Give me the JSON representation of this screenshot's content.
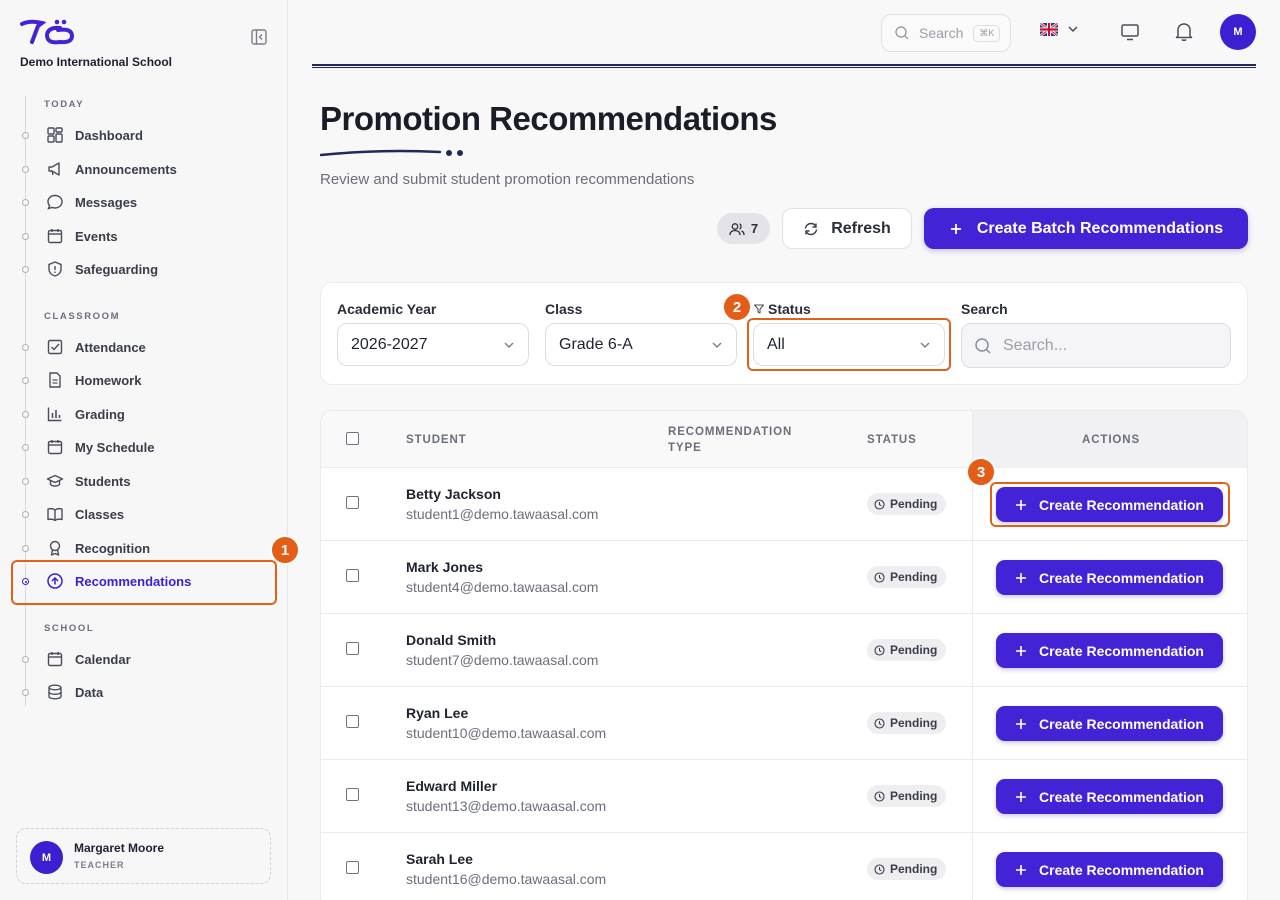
{
  "sidebar": {
    "brand_name": "Demo International School",
    "sections": {
      "today": "TODAY",
      "classroom": "CLASSROOM",
      "school": "SCHOOL"
    },
    "items": {
      "dashboard": "Dashboard",
      "announcements": "Announcements",
      "messages": "Messages",
      "events": "Events",
      "safeguarding": "Safeguarding",
      "attendance": "Attendance",
      "homework": "Homework",
      "grading": "Grading",
      "my_schedule": "My Schedule",
      "students": "Students",
      "classes": "Classes",
      "recognition": "Recognition",
      "recommendations": "Recommendations",
      "calendar": "Calendar",
      "data": "Data"
    },
    "active_item": "recommendations",
    "user": {
      "initial": "M",
      "name": "Margaret Moore",
      "role": "TEACHER"
    }
  },
  "topbar": {
    "search_placeholder": "Search",
    "search_shortcut": "⌘K",
    "avatar_initial": "M",
    "icons": [
      "search-icon",
      "uk-flag-icon",
      "chevron-down-icon",
      "monitor-icon",
      "bell-icon"
    ]
  },
  "header": {
    "title": "Promotion Recommendations",
    "subtitle": "Review and submit student promotion recommendations",
    "count": "7",
    "refresh_label": "Refresh",
    "batch_label": "Create Batch Recommendations"
  },
  "filters": {
    "academic_year": {
      "label": "Academic Year",
      "value": "2026-2027"
    },
    "class": {
      "label": "Class",
      "value": "Grade 6-A"
    },
    "status": {
      "label": "Status",
      "value": "All"
    },
    "search": {
      "label": "Search",
      "placeholder": "Search..."
    }
  },
  "table": {
    "headers": {
      "student": "STUDENT",
      "recommendation_type_1": "RECOMMENDATION",
      "recommendation_type_2": "TYPE",
      "status": "STATUS",
      "actions": "ACTIONS"
    },
    "action_label": "Create Recommendation",
    "rows": [
      {
        "name": "Betty Jackson",
        "email": "student1@demo.tawaasal.com",
        "status": "Pending"
      },
      {
        "name": "Mark Jones",
        "email": "student4@demo.tawaasal.com",
        "status": "Pending"
      },
      {
        "name": "Donald Smith",
        "email": "student7@demo.tawaasal.com",
        "status": "Pending"
      },
      {
        "name": "Ryan Lee",
        "email": "student10@demo.tawaasal.com",
        "status": "Pending"
      },
      {
        "name": "Edward Miller",
        "email": "student13@demo.tawaasal.com",
        "status": "Pending"
      },
      {
        "name": "Sarah Lee",
        "email": "student16@demo.tawaasal.com",
        "status": "Pending"
      }
    ]
  },
  "annotations": {
    "step1": "1",
    "step2": "2",
    "step3": "3"
  },
  "colors": {
    "accent": "#4422d6",
    "highlight": "#e0631b",
    "badge": "#e35d17"
  }
}
